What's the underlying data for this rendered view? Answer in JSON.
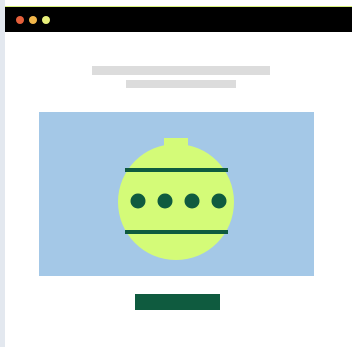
{
  "window": {
    "controls": [
      "close",
      "minimize",
      "maximize"
    ]
  },
  "colors": {
    "titlebar": "#000000",
    "close_dot": "#e5603b",
    "minimize_dot": "#f1b64a",
    "maximize_dot": "#e8f07a",
    "placeholder_text": "#dcdcdc",
    "hero_background": "#a4c8e7",
    "ornament_fill": "#d4fb78",
    "ornament_pattern": "#0f5b3f",
    "button": "#0f5b3f"
  },
  "hero": {
    "icon": "ornament-icon"
  },
  "cta": {
    "label": ""
  }
}
